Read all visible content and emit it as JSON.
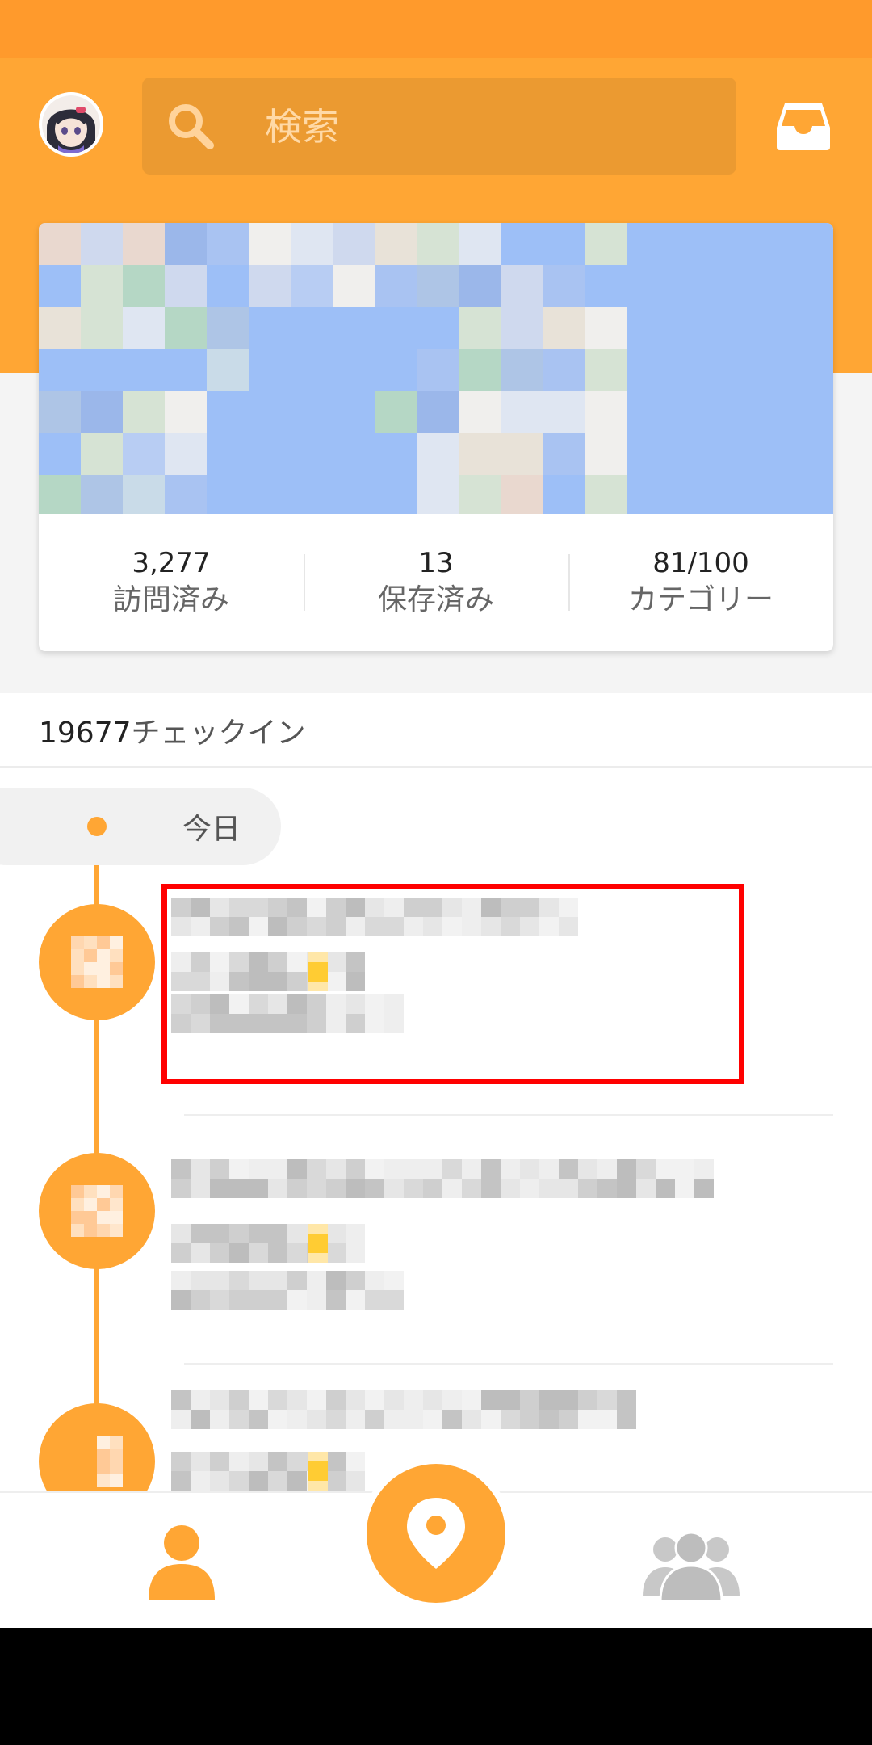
{
  "header": {
    "search_placeholder": "検索",
    "avatar_icon": "user-avatar-anime",
    "inbox_icon": "inbox-tray-icon"
  },
  "stats": {
    "visited": {
      "value": "3,277",
      "label": "訪問済み"
    },
    "saved": {
      "value": "13",
      "label": "保存済み"
    },
    "categories": {
      "value": "81/100",
      "label": "カテゴリー"
    }
  },
  "checkins": {
    "count": "19677",
    "unit": "チェックイン"
  },
  "timeline": {
    "today_label": "今日"
  },
  "bottom_nav": {
    "profile_icon": "person-icon",
    "checkin_icon": "location-pin-icon",
    "friends_icon": "group-icon"
  },
  "colors": {
    "accent": "#ffa634",
    "status_bar": "#ff9a2c",
    "search_bg": "#eb9a31",
    "highlight": "#ff0000"
  }
}
